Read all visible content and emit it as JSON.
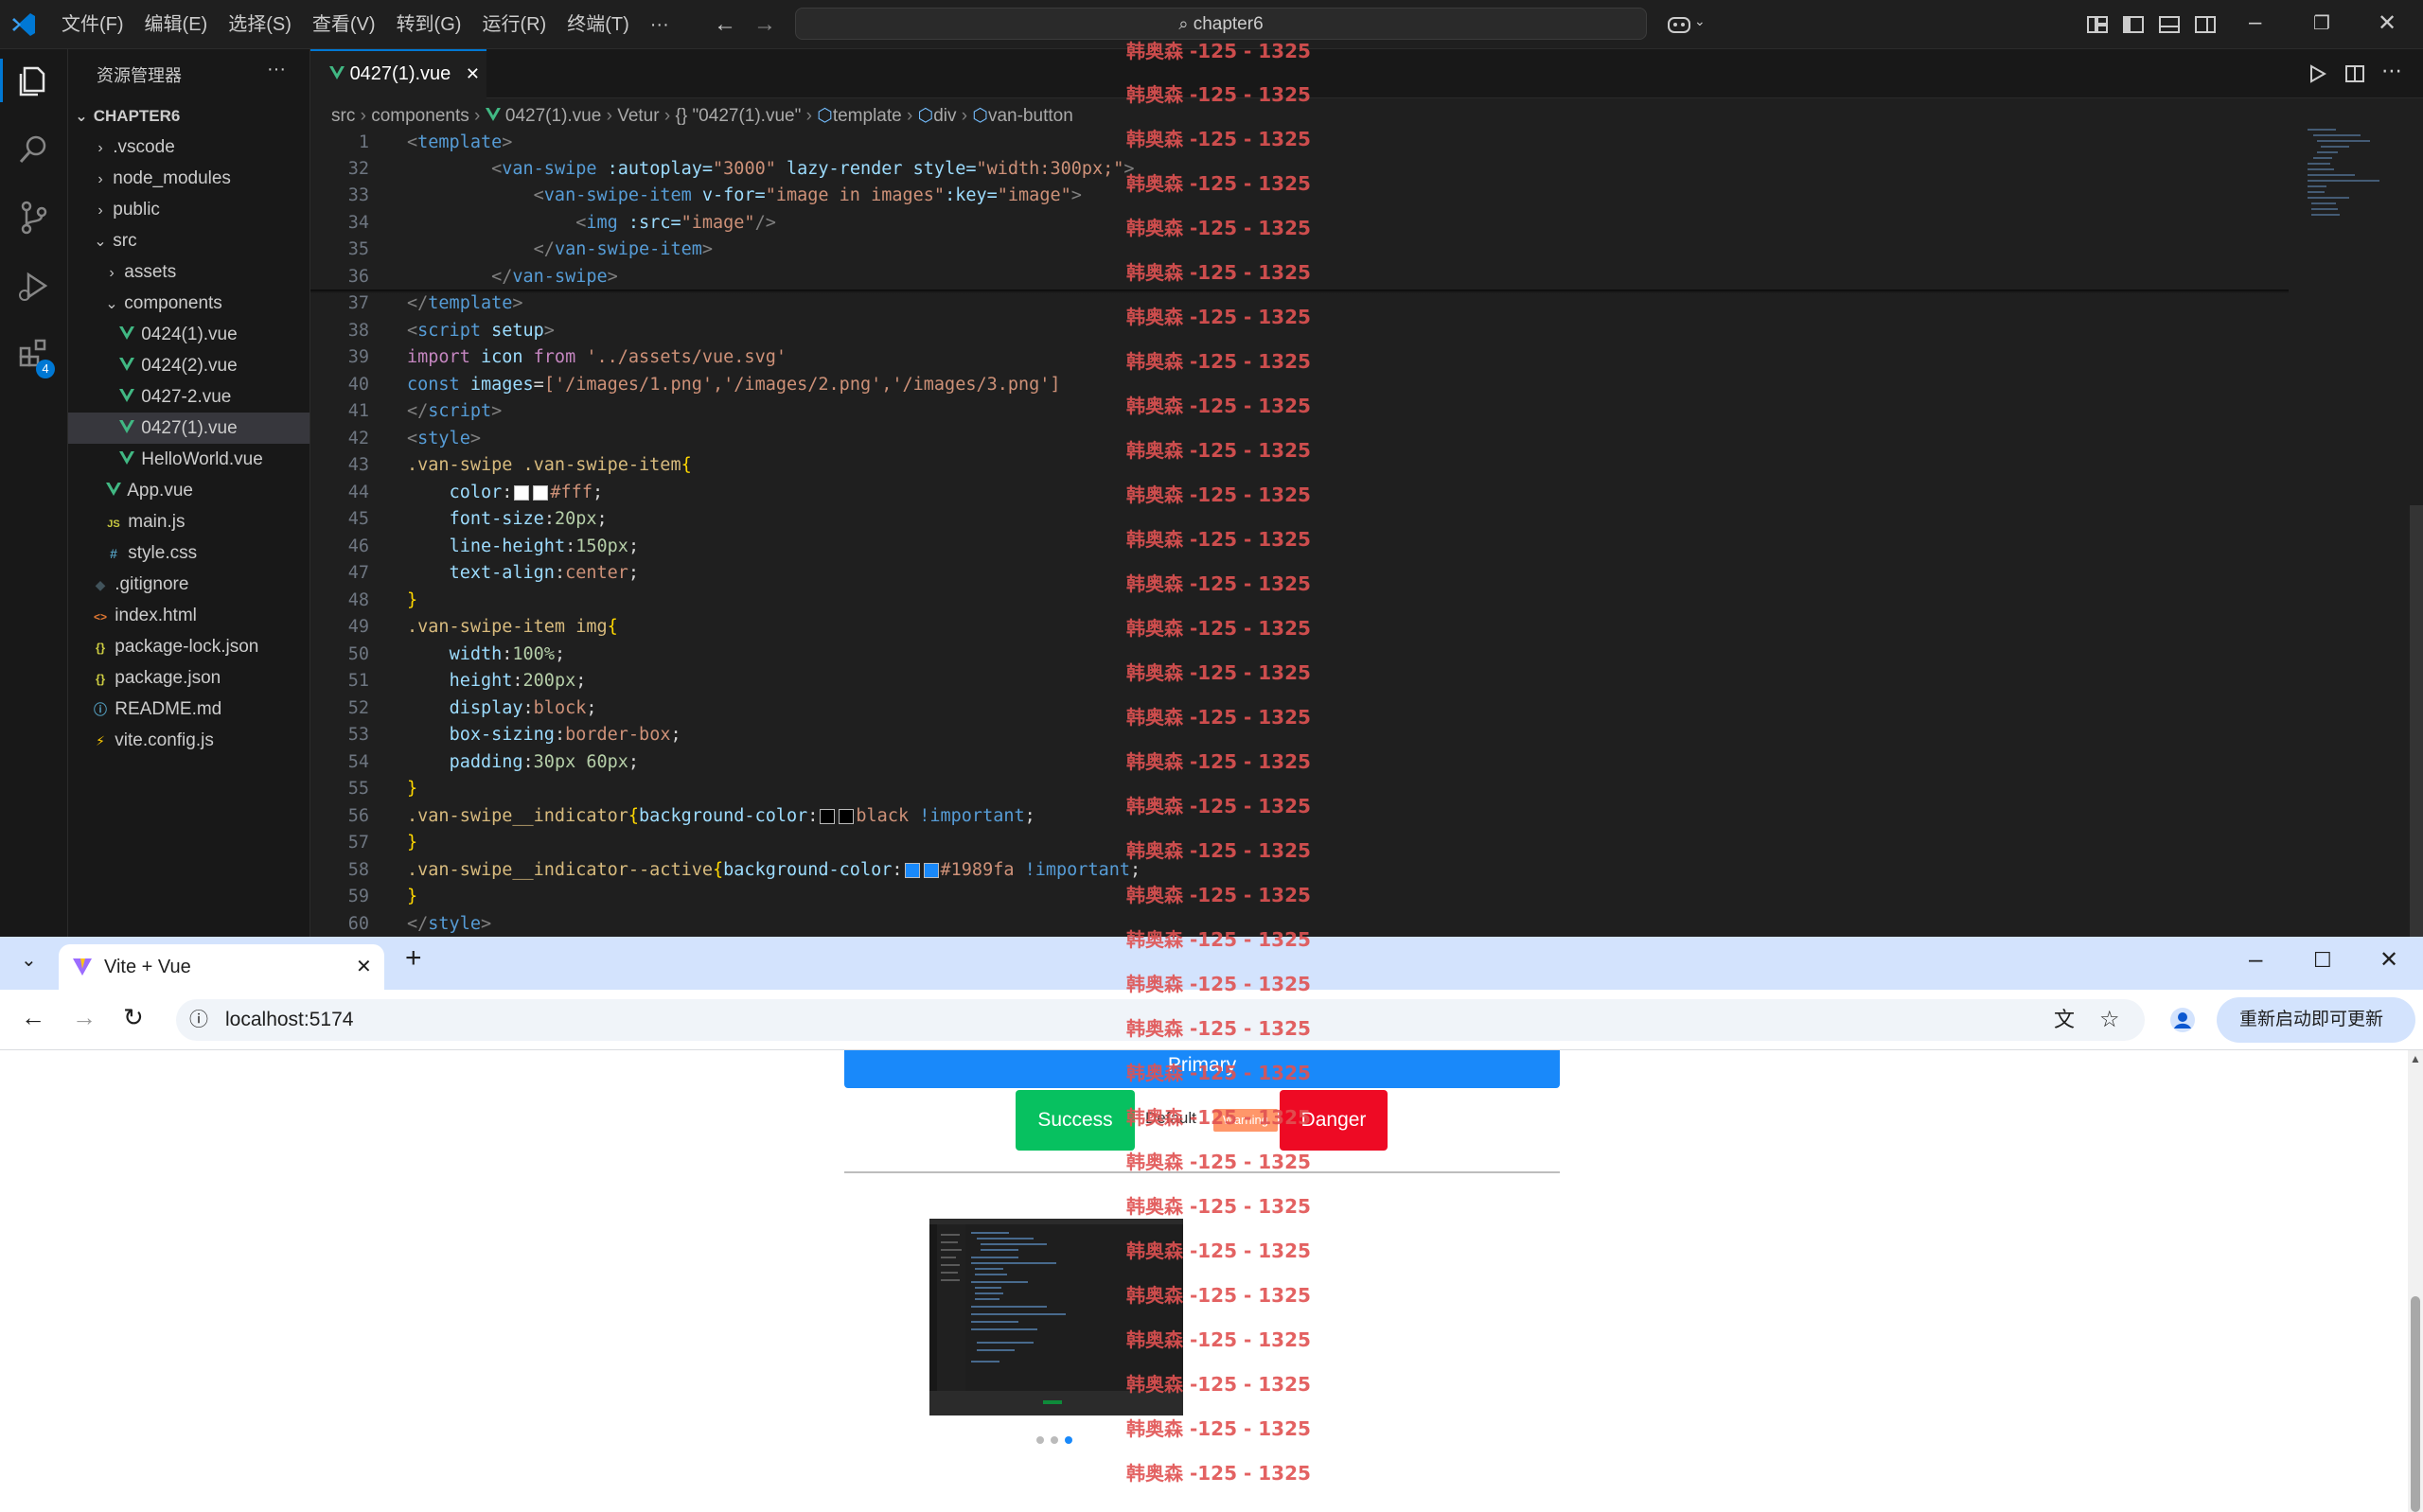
{
  "titlebar": {
    "menus": [
      "文件(F)",
      "编辑(E)",
      "选择(S)",
      "查看(V)",
      "转到(G)",
      "运行(R)",
      "终端(T)",
      "···"
    ],
    "search": "chapter6"
  },
  "activity": {
    "extensions_badge": "4"
  },
  "sidebar": {
    "title": "资源管理器",
    "more": "···",
    "root": "CHAPTER6",
    "items": [
      {
        "label": ".vscode"
      },
      {
        "label": "node_modules"
      },
      {
        "label": "public"
      },
      {
        "label": "src"
      },
      {
        "label": "assets"
      },
      {
        "label": "components"
      },
      {
        "label": "0424(1).vue"
      },
      {
        "label": "0424(2).vue"
      },
      {
        "label": "0427-2.vue"
      },
      {
        "label": "0427(1).vue"
      },
      {
        "label": "HelloWorld.vue"
      },
      {
        "label": "App.vue"
      },
      {
        "label": "main.js"
      },
      {
        "label": "style.css"
      },
      {
        "label": ".gitignore"
      },
      {
        "label": "index.html"
      },
      {
        "label": "package-lock.json"
      },
      {
        "label": "package.json"
      },
      {
        "label": "README.md"
      },
      {
        "label": "vite.config.js"
      }
    ],
    "icons": {
      "js": "JS",
      "css": "#",
      "html": "<>",
      "json": "{}",
      "info": "ⓘ"
    }
  },
  "editor": {
    "tab": "0427(1).vue",
    "breadcrumb": [
      "src",
      "components",
      "0427(1).vue",
      "Vetur",
      "{} \"0427(1).vue\"",
      "template",
      "div",
      "van-button"
    ],
    "line_numbers": [
      "1",
      "32",
      "33",
      "34",
      "35",
      "36",
      "37",
      "38",
      "39",
      "40",
      "41",
      "42",
      "43",
      "44",
      "45",
      "46",
      "47",
      "48",
      "49",
      "50",
      "51",
      "52",
      "53",
      "54",
      "55",
      "56",
      "57",
      "58",
      "59",
      "60"
    ],
    "code": {
      "l1": [
        "<",
        "template",
        ">"
      ],
      "l32": [
        "<",
        "van-swipe",
        " :autoplay=",
        "\"3000\"",
        " lazy-render",
        " style=",
        "\"width:300px;\"",
        ">"
      ],
      "l33": [
        "<",
        "van-swipe-item",
        " v-for=",
        "\"image in images\"",
        ":key=",
        "\"image\"",
        ">"
      ],
      "l34": [
        "<",
        "img",
        " :src=",
        "\"image\"",
        "/>"
      ],
      "l35": [
        "</",
        "van-swipe-item",
        ">"
      ],
      "l36": [
        "</",
        "van-swipe",
        ">"
      ],
      "l37": [
        "</",
        "template",
        ">"
      ],
      "l38": [
        "<",
        "script",
        " setup",
        ">"
      ],
      "l39": [
        "import",
        " icon ",
        "from",
        " '../assets/vue.svg'"
      ],
      "l40": [
        "const",
        " images",
        "=",
        "['/images/1.png','/images/2.png','/images/3.png']"
      ],
      "l41": [
        "</",
        "script",
        ">"
      ],
      "l42": [
        "<",
        "style",
        ">"
      ],
      "l43": [
        ".van-swipe .van-swipe-item",
        "{"
      ],
      "l44": [
        "color",
        ":",
        "#fff",
        ";"
      ],
      "l45": [
        "font-size",
        ":",
        "20px",
        ";"
      ],
      "l46": [
        "line-height",
        ":",
        "150px",
        ";"
      ],
      "l47": [
        "text-align",
        ":",
        "center",
        ";"
      ],
      "l48": [
        "}"
      ],
      "l49": [
        ".van-swipe-item img",
        "{"
      ],
      "l50": [
        "width",
        ":",
        "100%",
        ";"
      ],
      "l51": [
        "height",
        ":",
        "200px",
        ";"
      ],
      "l52": [
        "display",
        ":",
        "block",
        ";"
      ],
      "l53": [
        "box-sizing",
        ":",
        "border-box",
        ";"
      ],
      "l54": [
        "padding",
        ":",
        "30px 60px",
        ";"
      ],
      "l55": [
        "}"
      ],
      "l56": [
        ".van-swipe__indicator",
        "{",
        "background-color",
        ":",
        "black",
        " !important",
        ";"
      ],
      "l57": [
        "}"
      ],
      "l58": [
        ".van-swipe__indicator--active",
        "{",
        "background-color",
        ":",
        "#1989fa",
        " !important",
        ";"
      ],
      "l59": [
        "}"
      ],
      "l60": [
        "</",
        "style",
        ">"
      ]
    }
  },
  "browser": {
    "tab_title": "Vite + Vue",
    "new_tab": "+",
    "url": "localhost:5174",
    "update": "重新启动即可更新",
    "buttons": {
      "primary": "Primary",
      "success": "Success",
      "default": "Default",
      "warning": "Warning",
      "danger": "Danger"
    },
    "colors": {
      "primary": "#1989fa",
      "success": "#07c160",
      "warning": "#ff976a",
      "danger": "#ee0a24"
    }
  },
  "watermark": "韩奥森 -125 - 1325"
}
